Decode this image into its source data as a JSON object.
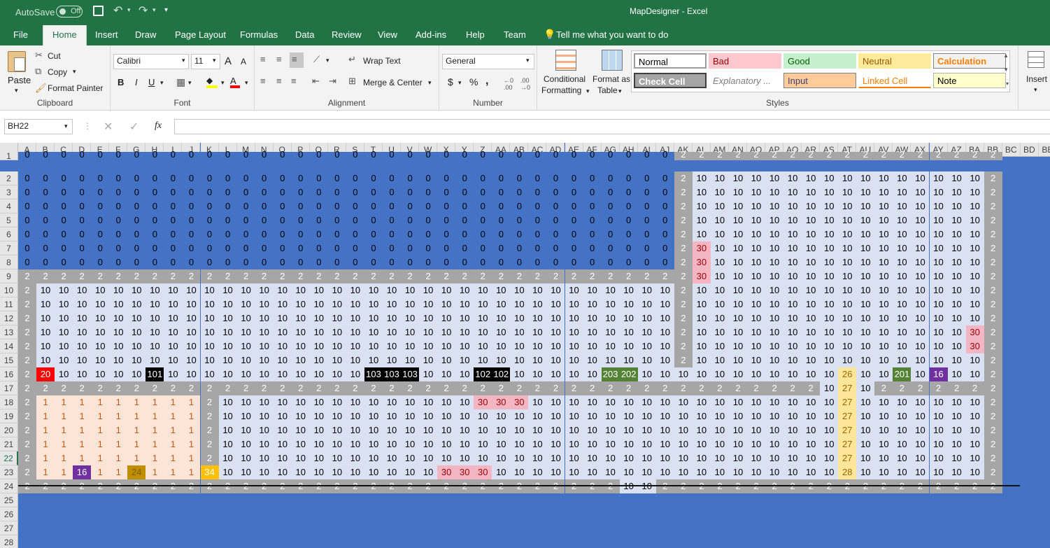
{
  "titlebar": {
    "autosave": "AutoSave",
    "autosave_state": "Off",
    "title": "MapDesigner  -  Excel"
  },
  "menu": [
    "File",
    "Home",
    "Insert",
    "Draw",
    "Page Layout",
    "Formulas",
    "Data",
    "Review",
    "View",
    "Add-ins",
    "Help",
    "Team"
  ],
  "tell_me": "Tell me what you want to do",
  "ribbon": {
    "clipboard": {
      "paste": "Paste",
      "cut": "Cut",
      "copy": "Copy",
      "format_painter": "Format Painter",
      "label": "Clipboard"
    },
    "font": {
      "name": "Calibri",
      "size": "11",
      "bold": "B",
      "italic": "I",
      "underline": "U",
      "grow": "A",
      "shrink": "A",
      "label": "Font"
    },
    "alignment": {
      "wrap": "Wrap Text",
      "merge": "Merge & Center",
      "label": "Alignment"
    },
    "number": {
      "format": "General",
      "currency": "$",
      "percent": "%",
      "comma": ",",
      "label": "Number"
    },
    "cond_format": [
      "Conditional",
      "Formatting"
    ],
    "format_table": [
      "Format as",
      "Table"
    ],
    "styles": {
      "label": "Styles",
      "items": [
        {
          "name": "Normal",
          "bg": "#ffffff",
          "fg": "#000000",
          "border": "#9c9c9c"
        },
        {
          "name": "Bad",
          "bg": "#ffc7ce",
          "fg": "#9c0006",
          "border": "#ffc7ce"
        },
        {
          "name": "Good",
          "bg": "#c6efce",
          "fg": "#006100",
          "border": "#c6efce"
        },
        {
          "name": "Neutral",
          "bg": "#ffeb9c",
          "fg": "#9c5700",
          "border": "#ffeb9c"
        },
        {
          "name": "Calculation",
          "bg": "#f2f2f2",
          "fg": "#fa7d00",
          "border": "#7f7f7f"
        },
        {
          "name": "Check Cell",
          "bg": "#a5a5a5",
          "fg": "#ffffff",
          "border": "#3f3f3f"
        },
        {
          "name": "Explanatory ...",
          "bg": "#ffffff",
          "fg": "#7f7f7f",
          "border": "#ffffff"
        },
        {
          "name": "Input",
          "bg": "#ffcc99",
          "fg": "#3f3f76",
          "border": "#7f7f7f"
        },
        {
          "name": "Linked Cell",
          "bg": "#ffffff",
          "fg": "#fa7d00",
          "border": "#ffffff"
        },
        {
          "name": "Note",
          "bg": "#ffffcc",
          "fg": "#000000",
          "border": "#b2b2b2"
        }
      ]
    },
    "insert": "Insert"
  },
  "namebox": "BH22",
  "fx": "fx",
  "columns": [
    "A",
    "B",
    "C",
    "D",
    "E",
    "F",
    "G",
    "H",
    "I",
    "J",
    "K",
    "L",
    "M",
    "N",
    "O",
    "P",
    "Q",
    "R",
    "S",
    "T",
    "U",
    "V",
    "W",
    "X",
    "Y",
    "Z",
    "AA",
    "AB",
    "AC",
    "AD",
    "AE",
    "AF",
    "AG",
    "AH",
    "AI",
    "AJ",
    "AK",
    "AL",
    "AM",
    "AN",
    "AO",
    "AP",
    "AQ",
    "AR",
    "AS",
    "AT",
    "AU",
    "AV",
    "AW",
    "AX",
    "AY",
    "AZ",
    "BA",
    "BB",
    "BC",
    "BD",
    "BE"
  ],
  "rows": [
    "1",
    "2",
    "3",
    "4",
    "5",
    "6",
    "7",
    "8",
    "9",
    "10",
    "11",
    "12",
    "13",
    "14",
    "15",
    "16",
    "17",
    "18",
    "19",
    "20",
    "21",
    "22",
    "23",
    "24",
    "25",
    "26",
    "27",
    "28"
  ],
  "colors": {
    "0": "#4472c4",
    "2": "#a6a6a6",
    "10": "#d9e1f2",
    "1": "#fce4d6",
    "20": "#ff0000",
    "30": "#f4b6c2",
    "101": "#000000",
    "102": "#000000",
    "103": "#000000",
    "201": "#548235",
    "202": "#548235",
    "203": "#548235",
    "16": "#7030a0",
    "24": "#bf8f00",
    "26": "#ffe699",
    "27": "#ffe699",
    "28": "#ffe699",
    "34": "#ffc000"
  },
  "sheet": [
    "0,0,0,0,0,0,0,0,0,0,0,0,0,0,0,0,0,0,0,0,0,0,0,0,0,0,0,0,0,0,0,0,0,0,0,0,2,2,2,2,2,2,2,2,2,2,2,2,2,2,2,2,2,2",
    "0,0,0,0,0,0,0,0,0,0,0,0,0,0,0,0,0,0,0,0,0,0,0,0,0,0,0,0,0,0,0,0,0,0,0,0,2,10,10,10,10,10,10,10,10,10,10,10,10,10,10,10,10,2",
    "0,0,0,0,0,0,0,0,0,0,0,0,0,0,0,0,0,0,0,0,0,0,0,0,0,0,0,0,0,0,0,0,0,0,0,0,2,10,10,10,10,10,10,10,10,10,10,10,10,10,10,10,10,2",
    "0,0,0,0,0,0,0,0,0,0,0,0,0,0,0,0,0,0,0,0,0,0,0,0,0,0,0,0,0,0,0,0,0,0,0,0,2,10,10,10,10,10,10,10,10,10,10,10,10,10,10,10,10,2",
    "0,0,0,0,0,0,0,0,0,0,0,0,0,0,0,0,0,0,0,0,0,0,0,0,0,0,0,0,0,0,0,0,0,0,0,0,2,10,10,10,10,10,10,10,10,10,10,10,10,10,10,10,10,2",
    "0,0,0,0,0,0,0,0,0,0,0,0,0,0,0,0,0,0,0,0,0,0,0,0,0,0,0,0,0,0,0,0,0,0,0,0,2,10,10,10,10,10,10,10,10,10,10,10,10,10,10,10,10,2",
    "0,0,0,0,0,0,0,0,0,0,0,0,0,0,0,0,0,0,0,0,0,0,0,0,0,0,0,0,0,0,0,0,0,0,0,0,2,30,10,10,10,10,10,10,10,10,10,10,10,10,10,10,10,2",
    "0,0,0,0,0,0,0,0,0,0,0,0,0,0,0,0,0,0,0,0,0,0,0,0,0,0,0,0,0,0,0,0,0,0,0,0,2,30,10,10,10,10,10,10,10,10,10,10,10,10,10,10,10,2",
    "2,2,2,2,2,2,2,2,2,2,2,2,2,2,2,2,2,2,2,2,2,2,2,2,2,2,2,2,2,2,2,2,2,2,2,2,2,30,10,10,10,10,10,10,10,10,10,10,10,10,10,10,10,2",
    "2,10,10,10,10,10,10,10,10,10,10,10,10,10,10,10,10,10,10,10,10,10,10,10,10,10,10,10,10,10,10,10,10,10,10,10,2,10,10,10,10,10,10,10,10,10,10,10,10,10,10,10,10,2",
    "2,10,10,10,10,10,10,10,10,10,10,10,10,10,10,10,10,10,10,10,10,10,10,10,10,10,10,10,10,10,10,10,10,10,10,10,2,10,10,10,10,10,10,10,10,10,10,10,10,10,10,10,10,2",
    "2,10,10,10,10,10,10,10,10,10,10,10,10,10,10,10,10,10,10,10,10,10,10,10,10,10,10,10,10,10,10,10,10,10,10,10,2,10,10,10,10,10,10,10,10,10,10,10,10,10,10,10,10,2",
    "2,10,10,10,10,10,10,10,10,10,10,10,10,10,10,10,10,10,10,10,10,10,10,10,10,10,10,10,10,10,10,10,10,10,10,10,2,10,10,10,10,10,10,10,10,10,10,10,10,10,10,10,30,2",
    "2,10,10,10,10,10,10,10,10,10,10,10,10,10,10,10,10,10,10,10,10,10,10,10,10,10,10,10,10,10,10,10,10,10,10,10,2,10,10,10,10,10,10,10,10,10,10,10,10,10,10,10,30,2",
    "2,10,10,10,10,10,10,10,10,10,10,10,10,10,10,10,10,10,10,10,10,10,10,10,10,10,10,10,10,10,10,10,10,10,10,10,2,10,10,10,10,10,10,10,10,10,10,10,10,10,10,10,10,2",
    "2,20,10,10,10,10,10,101,10,10,10,10,10,10,10,10,10,10,10,103,103,103,10,10,10,102,102,10,10,10,10,10,203,202,10,10,10,10,10,10,10,10,10,10,10,26,10,10,201,10,16,10,10,2",
    "2,2,2,2,2,2,2,2,2,2,2,2,2,2,2,2,2,2,2,2,2,2,2,2,2,2,2,2,2,2,2,2,2,2,2,2,2,2,2,2,2,2,2,2,10,27,10,2,2,2,2,2,2,2",
    "2,1,1,1,1,1,1,1,1,1,2,10,10,10,10,10,10,10,10,10,10,10,10,10,10,30,30,30,10,10,10,10,10,10,10,10,10,10,10,10,10,10,10,10,10,27,10,10,10,10,10,10,10,2",
    "2,1,1,1,1,1,1,1,1,1,2,10,10,10,10,10,10,10,10,10,10,10,10,10,10,10,10,10,10,10,10,10,10,10,10,10,10,10,10,10,10,10,10,10,10,27,10,10,10,10,10,10,10,2",
    "2,1,1,1,1,1,1,1,1,1,2,10,10,10,10,10,10,10,10,10,10,10,10,10,10,10,10,10,10,10,10,10,10,10,10,10,10,10,10,10,10,10,10,10,10,27,10,10,10,10,10,10,10,2",
    "2,1,1,1,1,1,1,1,1,1,2,10,10,10,10,10,10,10,10,10,10,10,10,10,10,10,10,10,10,10,10,10,10,10,10,10,10,10,10,10,10,10,10,10,10,27,10,10,10,10,10,10,10,2",
    "2,1,1,1,1,1,1,1,1,1,2,10,10,10,10,10,10,10,10,10,10,10,10,10,10,10,10,10,10,10,10,10,10,10,10,10,10,10,10,10,10,10,10,10,10,27,10,10,10,10,10,10,10,2",
    "2,1,1,16,1,1,24,1,1,1,34,10,10,10,10,10,10,10,10,10,10,10,10,30,30,30,10,10,10,10,10,10,10,10,10,10,10,10,10,10,10,10,10,10,10,28,10,10,10,10,10,10,10,2",
    "2,2,2,2,2,2,2,2,2,2,2,2,2,2,2,2,2,2,2,2,2,2,2,2,2,2,2,2,2,2,2,2,2,10,10,2,2,2,2,2,2,2,2,2,2,2,2,2,2,2,2,2,2,2"
  ]
}
